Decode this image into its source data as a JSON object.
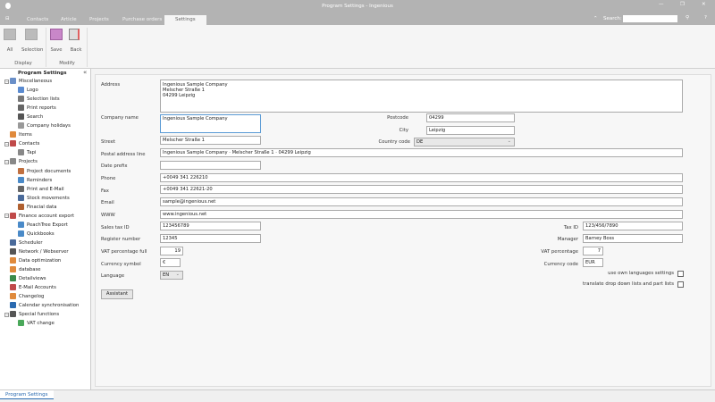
{
  "window": {
    "title": "Program Settings - Ingenious",
    "search_label": "Search:",
    "search_value": ""
  },
  "tabs": [
    "Contacts",
    "Article",
    "Projects",
    "Purchase orders",
    "Settings"
  ],
  "ribbon": {
    "display": {
      "group": "Display",
      "all": "All",
      "selection": "Selection"
    },
    "modify": {
      "group": "Modify",
      "save": "Save",
      "back": "Back"
    }
  },
  "sidebar": {
    "title": "Program Settings",
    "collapse": "«",
    "items": [
      {
        "label": "Miscellaneous",
        "level": 0,
        "toggle": true,
        "icon": "settings-icon",
        "color": "#6a8fc8"
      },
      {
        "label": "Logo",
        "level": 1,
        "icon": "image-icon",
        "color": "#5b8bd0"
      },
      {
        "label": "Selection lists",
        "level": 1,
        "icon": "list-icon",
        "color": "#777"
      },
      {
        "label": "Print reports",
        "level": 1,
        "icon": "printer-icon",
        "color": "#666"
      },
      {
        "label": "Search",
        "level": 1,
        "icon": "binoculars-icon",
        "color": "#555"
      },
      {
        "label": "Company holidays",
        "level": 1,
        "icon": "palm-icon",
        "color": "#999"
      },
      {
        "label": "Items",
        "level": 0,
        "icon": "box-icon",
        "color": "#e08a3c"
      },
      {
        "label": "Contacts",
        "level": 0,
        "toggle": true,
        "icon": "person-icon",
        "color": "#c04a4a"
      },
      {
        "label": "Tapi",
        "level": 1,
        "icon": "phone-icon",
        "color": "#888"
      },
      {
        "label": "Projects",
        "level": 0,
        "toggle": true,
        "icon": "document-icon",
        "color": "#888"
      },
      {
        "label": "Project documents",
        "level": 1,
        "icon": "doc-icon",
        "color": "#c07040"
      },
      {
        "label": "Reminders",
        "level": 1,
        "icon": "reminder-icon",
        "color": "#4a8ac8"
      },
      {
        "label": "Print and E-Mail",
        "level": 1,
        "icon": "printer-icon",
        "color": "#666"
      },
      {
        "label": "Stock movements",
        "level": 1,
        "icon": "stock-icon",
        "color": "#4a6a9a"
      },
      {
        "label": "Finacial data",
        "level": 1,
        "icon": "bank-icon",
        "color": "#b06030"
      },
      {
        "label": "Finance account export",
        "level": 0,
        "toggle": true,
        "icon": "export-icon",
        "color": "#c04a4a"
      },
      {
        "label": "PeachTree Export",
        "level": 1,
        "icon": "export-icon",
        "color": "#4a8ac8"
      },
      {
        "label": "Quickbooks",
        "level": 1,
        "icon": "export-icon",
        "color": "#4a8ac8"
      },
      {
        "label": "Scheduler",
        "level": 0,
        "icon": "clock-icon",
        "color": "#4a6a9a"
      },
      {
        "label": "Network / Webserver",
        "level": 0,
        "icon": "network-icon",
        "color": "#555"
      },
      {
        "label": "Data optimization",
        "level": 0,
        "icon": "optimize-icon",
        "color": "#e08a3c"
      },
      {
        "label": "database",
        "level": 0,
        "icon": "database-icon",
        "color": "#e08a3c"
      },
      {
        "label": "Detailviews",
        "level": 0,
        "icon": "grid-icon",
        "color": "#3a8a4a"
      },
      {
        "label": "E-Mail Accounts",
        "level": 0,
        "icon": "mail-icon",
        "color": "#c04a4a"
      },
      {
        "label": "Changelog",
        "level": 0,
        "icon": "changelog-icon",
        "color": "#e08a3c"
      },
      {
        "label": "Calendar synchronisation",
        "level": 0,
        "icon": "calendar-icon",
        "color": "#2a6ab0"
      },
      {
        "label": "Special functions",
        "level": 0,
        "toggle": true,
        "icon": "tools-icon",
        "color": "#555"
      },
      {
        "label": "VAT change",
        "level": 1,
        "icon": "vat-icon",
        "color": "#4aa85a"
      }
    ]
  },
  "form": {
    "address": {
      "label": "Address",
      "value": "Ingenious Sample Company\nMelscher Straße 1\n04299 Leipzig"
    },
    "company_name": {
      "label": "Company name",
      "value": "Ingenious Sample Company"
    },
    "street": {
      "label": "Street",
      "value": "Melscher Straße 1"
    },
    "postal_line": {
      "label": "Postal address line",
      "value": "Ingenious Sample Company · Melscher Straße 1 · 04299 Leipzig"
    },
    "date_prefix": {
      "label": "Date prefix",
      "value": ""
    },
    "phone": {
      "label": "Phone",
      "value": "+0049 341 226210"
    },
    "fax": {
      "label": "Fax",
      "value": "+0049 341 22621-20"
    },
    "email": {
      "label": "Email",
      "value": "sample@ingenious.net"
    },
    "www": {
      "label": "WWW",
      "value": "www.ingenious.net"
    },
    "sales_tax": {
      "label": "Sales tax ID",
      "value": "123456789"
    },
    "register": {
      "label": "Register number",
      "value": "12345"
    },
    "vat_full": {
      "label": "VAT percentage full",
      "value": "19"
    },
    "currency_symbol": {
      "label": "Currency symbol",
      "value": "€"
    },
    "language": {
      "label": "Language",
      "value": "EN"
    },
    "postcode": {
      "label": "Postcode",
      "value": "04299"
    },
    "city": {
      "label": "City",
      "value": "Leipzig"
    },
    "country": {
      "label": "Country code",
      "value": "DE"
    },
    "tax_id": {
      "label": "Tax ID",
      "value": "123/456/7890"
    },
    "manager": {
      "label": "Manager",
      "value": "Barney Boss"
    },
    "vat": {
      "label": "VAT percentage",
      "value": "7"
    },
    "currency_code": {
      "label": "Currency code",
      "value": "EUR"
    },
    "own_lang": {
      "label": "use own languages settings",
      "checked": false
    },
    "translate": {
      "label": "translate drop down lists and part lists",
      "checked": false
    },
    "assistant": "Assistant"
  },
  "status_tab": "Program Settings"
}
